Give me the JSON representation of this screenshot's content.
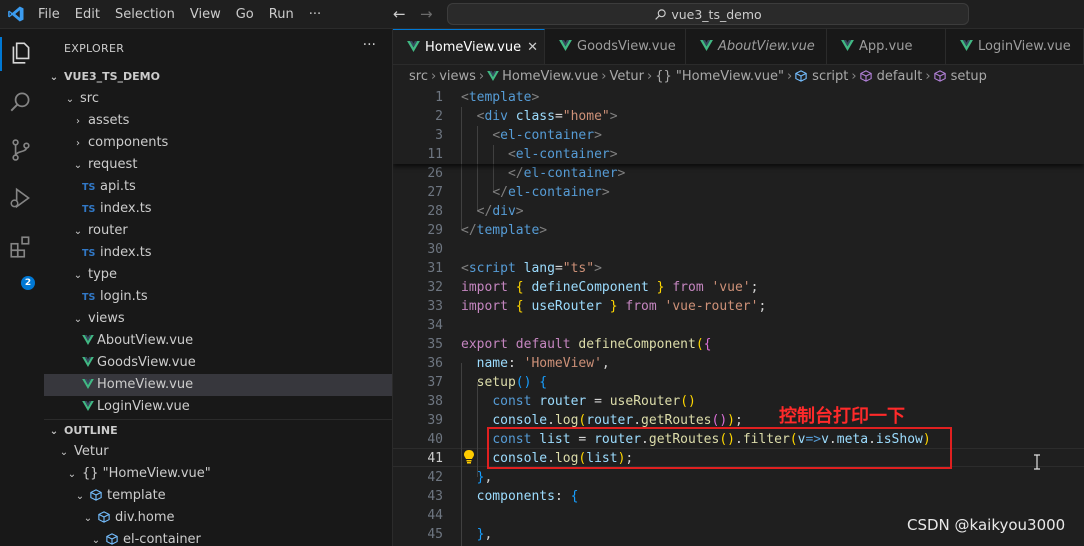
{
  "titlebar": {
    "menus": [
      "File",
      "Edit",
      "Selection",
      "View",
      "Go",
      "Run",
      "···"
    ],
    "search_text": "vue3_ts_demo",
    "back_icon": "arrow-left-icon",
    "forward_icon": "arrow-right-icon"
  },
  "activity_badge": "2",
  "explorer": {
    "title": "EXPLORER",
    "more": "···",
    "project": "VUE3_TS_DEMO",
    "items": [
      {
        "label": "src",
        "chev": "⌄",
        "type": "folder"
      },
      {
        "label": "assets",
        "chev": "›",
        "type": "folder"
      },
      {
        "label": "components",
        "chev": "›",
        "type": "folder"
      },
      {
        "label": "request",
        "chev": "⌄",
        "type": "folder"
      },
      {
        "label": "api.ts",
        "type": "ts",
        "badge": "TS"
      },
      {
        "label": "index.ts",
        "type": "ts",
        "badge": "TS"
      },
      {
        "label": "router",
        "chev": "⌄",
        "type": "folder"
      },
      {
        "label": "index.ts",
        "type": "ts",
        "badge": "TS"
      },
      {
        "label": "type",
        "chev": "⌄",
        "type": "folder"
      },
      {
        "label": "login.ts",
        "type": "ts",
        "badge": "TS"
      },
      {
        "label": "views",
        "chev": "⌄",
        "type": "folder"
      },
      {
        "label": "AboutView.vue",
        "type": "vue"
      },
      {
        "label": "GoodsView.vue",
        "type": "vue"
      },
      {
        "label": "HomeView.vue",
        "type": "vue",
        "selected": true
      },
      {
        "label": "LoginView.vue",
        "type": "vue"
      }
    ]
  },
  "outline": {
    "title": "OUTLINE",
    "items": [
      {
        "label": "Vetur",
        "chev": "⌄"
      },
      {
        "label": "{} \"HomeView.vue\"",
        "chev": "⌄"
      },
      {
        "label": "template",
        "chev": "⌄"
      },
      {
        "label": "div.home",
        "chev": "⌄"
      },
      {
        "label": "el-container",
        "chev": "⌄"
      }
    ]
  },
  "tabs": [
    {
      "label": "HomeView.vue",
      "active": true,
      "close": "✕"
    },
    {
      "label": "GoodsView.vue"
    },
    {
      "label": "AboutView.vue",
      "italic": true
    },
    {
      "label": "App.vue"
    },
    {
      "label": "LoginView.vue"
    }
  ],
  "breadcrumb": {
    "items": [
      "src",
      "views",
      "HomeView.vue",
      "Vetur",
      "{} \"HomeView.vue\"",
      "script",
      "default",
      "setup"
    ],
    "sep": "›"
  },
  "editor": {
    "sticky_lines": [
      {
        "n": "1",
        "t": [
          [
            "t-tag",
            "<"
          ],
          [
            "t-name",
            "template"
          ],
          [
            "t-tag",
            ">"
          ]
        ]
      },
      {
        "n": "2",
        "t": [
          [
            "t-plain",
            "  "
          ],
          [
            "t-tag",
            "<"
          ],
          [
            "t-name",
            "div "
          ],
          [
            "t-attr",
            "class"
          ],
          [
            "t-plain",
            "="
          ],
          [
            "t-str",
            "\"home\""
          ],
          [
            "t-tag",
            ">"
          ]
        ]
      },
      {
        "n": "3",
        "t": [
          [
            "t-plain",
            "    "
          ],
          [
            "t-tag",
            "<"
          ],
          [
            "t-name",
            "el-container"
          ],
          [
            "t-tag",
            ">"
          ]
        ]
      },
      {
        "n": "11",
        "t": [
          [
            "t-plain",
            "      "
          ],
          [
            "t-tag",
            "<"
          ],
          [
            "t-name",
            "el-container"
          ],
          [
            "t-tag",
            ">"
          ]
        ]
      }
    ],
    "lines": [
      {
        "n": "26",
        "t": [
          [
            "t-plain",
            "      "
          ],
          [
            "t-tag",
            "</"
          ],
          [
            "t-name",
            "el-container"
          ],
          [
            "t-tag",
            ">"
          ]
        ]
      },
      {
        "n": "27",
        "t": [
          [
            "t-plain",
            "    "
          ],
          [
            "t-tag",
            "</"
          ],
          [
            "t-name",
            "el-container"
          ],
          [
            "t-tag",
            ">"
          ]
        ]
      },
      {
        "n": "28",
        "t": [
          [
            "t-plain",
            "  "
          ],
          [
            "t-tag",
            "</"
          ],
          [
            "t-name",
            "div"
          ],
          [
            "t-tag",
            ">"
          ]
        ]
      },
      {
        "n": "29",
        "t": [
          [
            "t-tag",
            "</"
          ],
          [
            "t-name",
            "template"
          ],
          [
            "t-tag",
            ">"
          ]
        ]
      },
      {
        "n": "30",
        "t": []
      },
      {
        "n": "31",
        "t": [
          [
            "t-tag",
            "<"
          ],
          [
            "t-name",
            "script "
          ],
          [
            "t-attr",
            "lang"
          ],
          [
            "t-plain",
            "="
          ],
          [
            "t-str",
            "\"ts\""
          ],
          [
            "t-tag",
            ">"
          ]
        ]
      },
      {
        "n": "32",
        "t": [
          [
            "t-kw",
            "import "
          ],
          [
            "t-br1",
            "{ "
          ],
          [
            "t-var",
            "defineComponent"
          ],
          [
            "t-br1",
            " }"
          ],
          [
            "t-kw",
            " from "
          ],
          [
            "t-str",
            "'vue'"
          ],
          [
            "t-plain",
            ";"
          ]
        ]
      },
      {
        "n": "33",
        "t": [
          [
            "t-kw",
            "import "
          ],
          [
            "t-br1",
            "{ "
          ],
          [
            "t-var",
            "useRouter"
          ],
          [
            "t-br1",
            " }"
          ],
          [
            "t-kw",
            " from "
          ],
          [
            "t-str",
            "'vue-router'"
          ],
          [
            "t-plain",
            ";"
          ]
        ]
      },
      {
        "n": "34",
        "t": []
      },
      {
        "n": "35",
        "t": [
          [
            "t-kw",
            "export default "
          ],
          [
            "t-fn",
            "defineComponent"
          ],
          [
            "t-br1",
            "("
          ],
          [
            "t-br2",
            "{"
          ]
        ]
      },
      {
        "n": "36",
        "t": [
          [
            "t-plain",
            "  "
          ],
          [
            "t-var",
            "name"
          ],
          [
            "t-plain",
            ": "
          ],
          [
            "t-str",
            "'HomeView'"
          ],
          [
            "t-plain",
            ","
          ]
        ]
      },
      {
        "n": "37",
        "t": [
          [
            "t-plain",
            "  "
          ],
          [
            "t-fn",
            "setup"
          ],
          [
            "t-br3",
            "()"
          ],
          [
            "t-plain",
            " "
          ],
          [
            "t-br3",
            "{"
          ]
        ]
      },
      {
        "n": "38",
        "t": [
          [
            "t-plain",
            "    "
          ],
          [
            "t-kw2",
            "const "
          ],
          [
            "t-var",
            "router"
          ],
          [
            "t-plain",
            " = "
          ],
          [
            "t-fn",
            "useRouter"
          ],
          [
            "t-br1",
            "()"
          ]
        ]
      },
      {
        "n": "39",
        "t": [
          [
            "t-plain",
            "    "
          ],
          [
            "t-var",
            "console"
          ],
          [
            "t-plain",
            "."
          ],
          [
            "t-fn",
            "log"
          ],
          [
            "t-br1",
            "("
          ],
          [
            "t-var",
            "router"
          ],
          [
            "t-plain",
            "."
          ],
          [
            "t-fn",
            "getRoutes"
          ],
          [
            "t-br2",
            "()"
          ],
          [
            "t-br1",
            ")"
          ],
          [
            "t-plain",
            ";"
          ]
        ]
      },
      {
        "n": "40",
        "t": [
          [
            "t-plain",
            "    "
          ],
          [
            "t-kw2",
            "const "
          ],
          [
            "t-var",
            "list"
          ],
          [
            "t-plain",
            " = "
          ],
          [
            "t-var",
            "router"
          ],
          [
            "t-plain",
            "."
          ],
          [
            "t-fn",
            "getRoutes"
          ],
          [
            "t-br1",
            "()"
          ],
          [
            "t-plain",
            "."
          ],
          [
            "t-fn",
            "filter"
          ],
          [
            "t-br1",
            "("
          ],
          [
            "t-var",
            "v"
          ],
          [
            "t-kw2",
            "=>"
          ],
          [
            "t-var",
            "v"
          ],
          [
            "t-plain",
            "."
          ],
          [
            "t-var",
            "meta"
          ],
          [
            "t-plain",
            "."
          ],
          [
            "t-var",
            "isShow"
          ],
          [
            "t-br1",
            ")"
          ]
        ]
      },
      {
        "n": "41",
        "t": [
          [
            "t-plain",
            "    "
          ],
          [
            "t-var",
            "console"
          ],
          [
            "t-plain",
            "."
          ],
          [
            "t-fn",
            "log"
          ],
          [
            "t-br1",
            "("
          ],
          [
            "t-var",
            "list"
          ],
          [
            "t-br1",
            ")"
          ],
          [
            "t-plain",
            ";"
          ]
        ],
        "current": true
      },
      {
        "n": "42",
        "t": [
          [
            "t-plain",
            "  "
          ],
          [
            "t-br3",
            "}"
          ],
          [
            "t-plain",
            ","
          ]
        ]
      },
      {
        "n": "43",
        "t": [
          [
            "t-plain",
            "  "
          ],
          [
            "t-var",
            "components"
          ],
          [
            "t-plain",
            ": "
          ],
          [
            "t-br3",
            "{"
          ]
        ]
      },
      {
        "n": "44",
        "t": []
      },
      {
        "n": "45",
        "t": [
          [
            "t-plain",
            "  "
          ],
          [
            "t-br3",
            "}"
          ],
          [
            "t-plain",
            ","
          ]
        ]
      }
    ],
    "annotation": "控制台打印一下",
    "watermark": "CSDN @kaikyou3000"
  }
}
